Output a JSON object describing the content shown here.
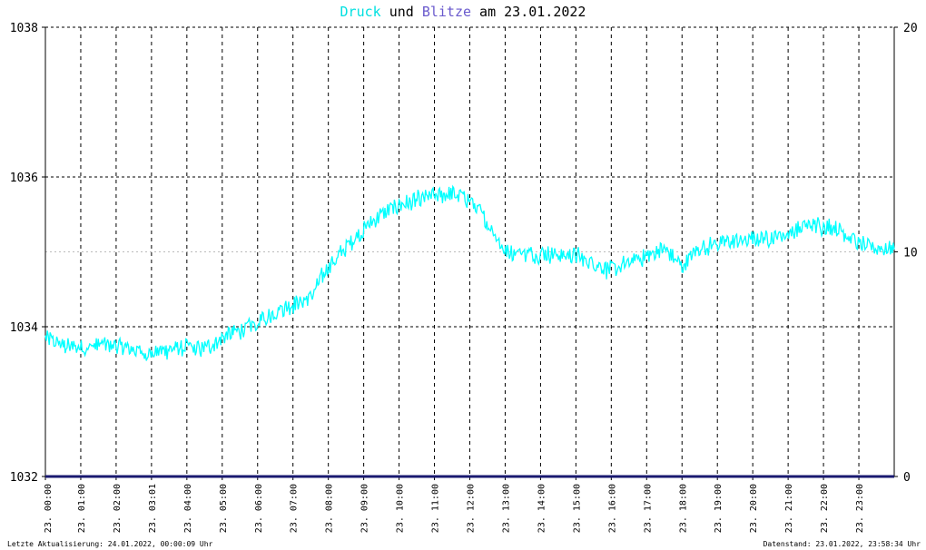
{
  "title": {
    "part1": "Druck",
    "part2": " und ",
    "part3": "Blitze",
    "part4": " am 23.01.2022"
  },
  "colors": {
    "druck": "#00ffff",
    "blitze": "#191970",
    "title_druck": "#00e0e0",
    "title_blitze": "#6a5acd"
  },
  "footer": {
    "left": "Letzte Aktualisierung: 24.01.2022, 00:00:09 Uhr",
    "right": "Datenstand: 23.01.2022, 23:58:34 Uhr"
  },
  "chart_data": {
    "type": "line",
    "xlabel": "",
    "ylabel": "",
    "ylim_left": [
      1032,
      1038
    ],
    "ylim_right": [
      0,
      20
    ],
    "xlim_hours": [
      0,
      24
    ],
    "left_ticks": [
      "1032",
      "1034",
      "1036",
      "1038"
    ],
    "right_ticks": [
      "0",
      "10",
      "20"
    ],
    "x_tick_labels": [
      "23. 00:00",
      "23. 01:00",
      "23. 02:00",
      "23. 03:01",
      "23. 04:00",
      "23. 05:00",
      "23. 06:00",
      "23. 07:00",
      "23. 08:00",
      "23. 09:00",
      "23. 10:00",
      "23. 11:00",
      "23. 12:00",
      "23. 13:00",
      "23. 14:00",
      "23. 15:00",
      "23. 16:00",
      "23. 17:00",
      "23. 18:00",
      "23. 19:00",
      "23. 20:00",
      "23. 21:00",
      "23. 22:00",
      "23. 23:00"
    ],
    "grid": true,
    "series": [
      {
        "name": "Druck",
        "axis": "left",
        "x": [
          0,
          0.5,
          1,
          1.5,
          2,
          2.5,
          3,
          3.5,
          4,
          4.5,
          5,
          5.5,
          6,
          6.5,
          7,
          7.5,
          8,
          8.5,
          9,
          9.5,
          10,
          10.5,
          11,
          11.5,
          12,
          12.5,
          13,
          13.5,
          14,
          14.5,
          15,
          15.5,
          16,
          16.5,
          17,
          17.5,
          18,
          18.5,
          19,
          19.5,
          20,
          20.5,
          21,
          21.5,
          22,
          22.5,
          23,
          23.5,
          24
        ],
        "y": [
          1033.85,
          1033.75,
          1033.72,
          1033.75,
          1033.75,
          1033.7,
          1033.65,
          1033.7,
          1033.72,
          1033.7,
          1033.85,
          1033.95,
          1034.05,
          1034.2,
          1034.3,
          1034.4,
          1034.8,
          1035.05,
          1035.3,
          1035.5,
          1035.62,
          1035.68,
          1035.75,
          1035.78,
          1035.7,
          1035.4,
          1035.0,
          1034.98,
          1034.98,
          1034.97,
          1034.95,
          1034.85,
          1034.75,
          1034.85,
          1034.95,
          1035.05,
          1034.8,
          1035.05,
          1035.1,
          1035.15,
          1035.15,
          1035.2,
          1035.25,
          1035.35,
          1035.35,
          1035.3,
          1035.1,
          1035.05,
          1035.05
        ]
      },
      {
        "name": "Blitze",
        "axis": "right",
        "x": [
          0,
          24
        ],
        "y": [
          0,
          0
        ]
      }
    ]
  }
}
